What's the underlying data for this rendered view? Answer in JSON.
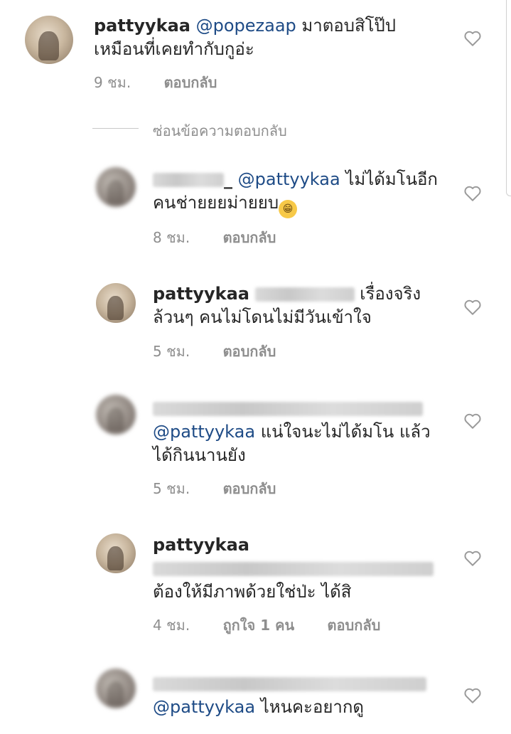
{
  "comments": [
    {
      "username": "pattyykaa",
      "mention": "@popezaap",
      "text_line1": "มาตอบสิโป๊ป",
      "text_line2": "เหมือนที่เคยทำกับกูอ่ะ",
      "time": "9 ชม.",
      "reply": "ตอบกลับ"
    },
    {
      "username_tail": "_",
      "mention": "@pattyykaa",
      "text_line1": "ไม่ได้มโนอีก",
      "text_line2": "คนช่ายยยม่ายยบ",
      "emoji": "😁",
      "time": "8 ชม.",
      "reply": "ตอบกลับ"
    },
    {
      "username": "pattyykaa",
      "text_line1": "เรื่องจริง",
      "text_line2": "ล้วนๆ คนไม่โดนไม่มีวันเข้าใจ",
      "time": "5 ชม.",
      "reply": "ตอบกลับ"
    },
    {
      "mention": "@pattyykaa",
      "text_line1": "แน่ใจนะไม่ได้มโน แล้ว",
      "text_line2": "ได้กินนานยัง",
      "time": "5 ชม.",
      "reply": "ตอบกลับ"
    },
    {
      "username": "pattyykaa",
      "text_line2": "ต้องให้มีภาพด้วยใช่ป่ะ ได้สิ",
      "time": "4 ชม.",
      "likes": "ถูกใจ 1 คน",
      "reply": "ตอบกลับ"
    },
    {
      "mention": "@pattyykaa",
      "text_line1": "ไหนคะอยากดู"
    }
  ],
  "hide_replies": "ซ่อนข้อความตอบกลับ",
  "icons": {
    "like": "heart-outline-icon"
  },
  "colors": {
    "mention": "#1e4b86",
    "meta": "#8e8e8e",
    "text": "#262626"
  }
}
